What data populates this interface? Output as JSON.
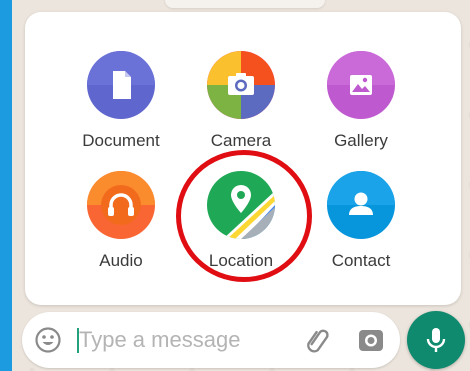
{
  "attach_menu": {
    "items": [
      {
        "label": "Document",
        "icon": "document-icon",
        "color": "#5f66cd"
      },
      {
        "label": "Camera",
        "icon": "camera-icon",
        "color": "#ec407a"
      },
      {
        "label": "Gallery",
        "icon": "gallery-icon",
        "color": "#bf59cf"
      },
      {
        "label": "Audio",
        "icon": "headphones-icon",
        "color": "#f96533"
      },
      {
        "label": "Location",
        "icon": "map-pin-icon",
        "color": "#1fa855"
      },
      {
        "label": "Contact",
        "icon": "person-icon",
        "color": "#0795dc"
      }
    ],
    "highlighted": "Location",
    "highlight_color": "#e00d13"
  },
  "composer": {
    "placeholder": "Type a message",
    "accent": "#0f8a6f"
  }
}
